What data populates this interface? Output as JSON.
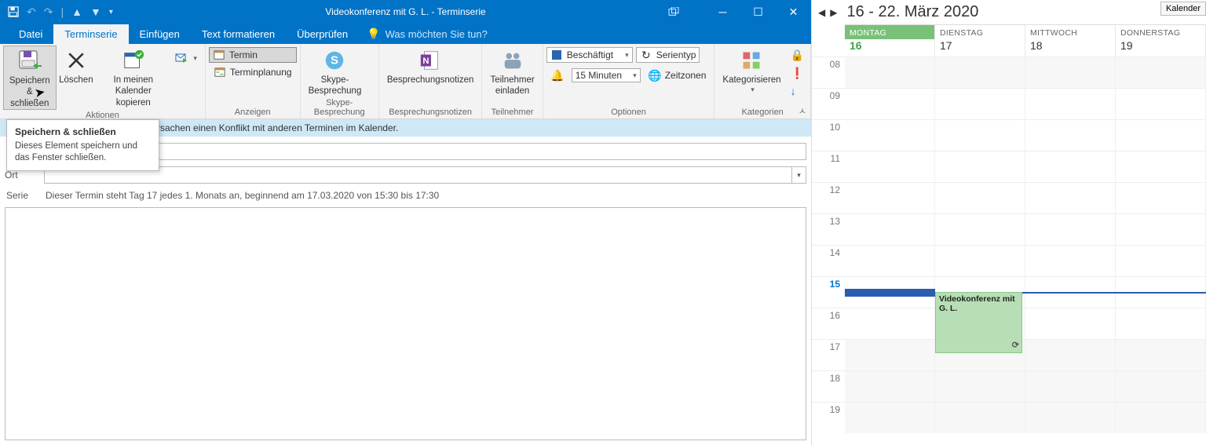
{
  "window": {
    "title": "Videokonferenz mit G. L. - Terminserie"
  },
  "tabs": {
    "datei": "Datei",
    "terminserie": "Terminserie",
    "einfuegen": "Einfügen",
    "textformat": "Text formatieren",
    "ueberpruefen": "Überprüfen",
    "tellme": "Was möchten Sie tun?"
  },
  "ribbon": {
    "save_close": "Speichern\n& schließen",
    "delete": "Löschen",
    "copy_cal": "In meinen\nKalender kopieren",
    "group_aktionen": "Aktionen",
    "termin": "Termin",
    "terminplanung": "Terminplanung",
    "group_anzeigen": "Anzeigen",
    "skype": "Skype-\nBesprechung",
    "group_skype": "Skype-Besprechung",
    "notes": "Besprechungsnotizen",
    "group_notes": "Besprechungsnotizen",
    "teilnehmer": "Teilnehmer\neinladen",
    "group_teilnehmer": "Teilnehmer",
    "status_label": "Beschäftigt",
    "serientyp": "Serientyp",
    "reminder": "15 Minuten",
    "zeitzonen": "Zeitzonen",
    "group_optionen": "Optionen",
    "kategorisieren": "Kategorisieren",
    "group_kategorien": "Kategorien"
  },
  "tooltip": {
    "title": "Speichern & schließen",
    "body": "Dieses Element speichern und das Fenster schließen."
  },
  "conflict": "rsachen einen Konflikt mit anderen Terminen im Kalender.",
  "form": {
    "ort": "Ort",
    "serie_label": "Serie",
    "serie_text": "Dieser Termin steht Tag 17 jedes 1. Monats an, beginnend am 17.03.2020 von 15:30 bis 17:30"
  },
  "calendar": {
    "range": "16 - 22. März 2020",
    "btn": "Kalender",
    "days": [
      {
        "name": "MONTAG",
        "num": "16",
        "today": true
      },
      {
        "name": "DIENSTAG",
        "num": "17"
      },
      {
        "name": "MITTWOCH",
        "num": "18"
      },
      {
        "name": "DONNERSTAG",
        "num": "19"
      }
    ],
    "hours": [
      "08",
      "09",
      "10",
      "11",
      "12",
      "13",
      "14",
      "15",
      "16",
      "17",
      "18",
      "19"
    ],
    "marked_hour": "15",
    "event_title": "Videokonferenz mit G. L."
  }
}
